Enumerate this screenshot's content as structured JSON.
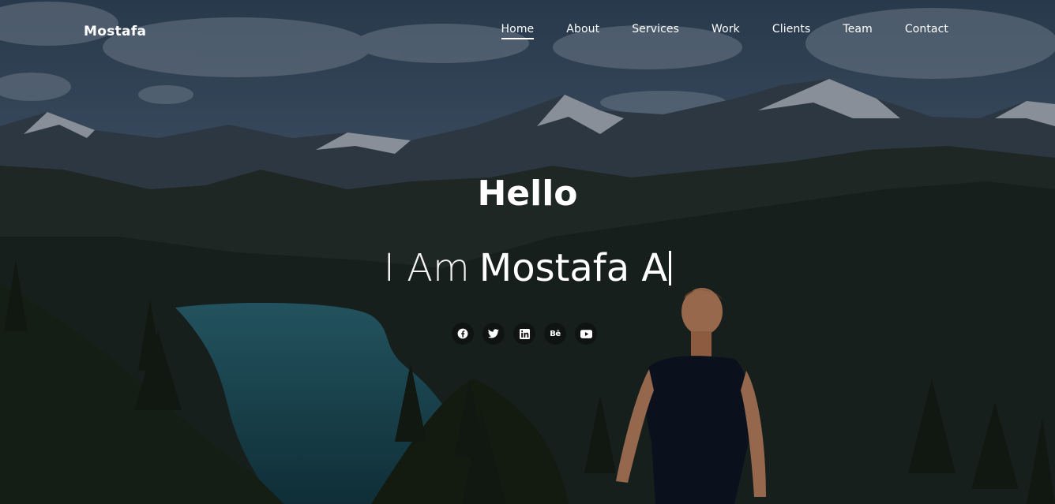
{
  "brand": {
    "name": "Mostafa"
  },
  "nav": {
    "items": [
      {
        "label": "Home",
        "active": true
      },
      {
        "label": "About"
      },
      {
        "label": "Services"
      },
      {
        "label": "Work"
      },
      {
        "label": "Clients"
      },
      {
        "label": "Team"
      },
      {
        "label": "Contact"
      }
    ]
  },
  "hero": {
    "greeting": "Hello",
    "intro_prefix": "I Am",
    "typed_text": "Mostafa A"
  },
  "social": {
    "icons": [
      "facebook-icon",
      "twitter-icon",
      "linkedin-icon",
      "behance-icon",
      "youtube-icon"
    ],
    "behance_glyph": "Bē"
  },
  "colors": {
    "text": "#ffffff",
    "overlay": "#0b1118"
  }
}
